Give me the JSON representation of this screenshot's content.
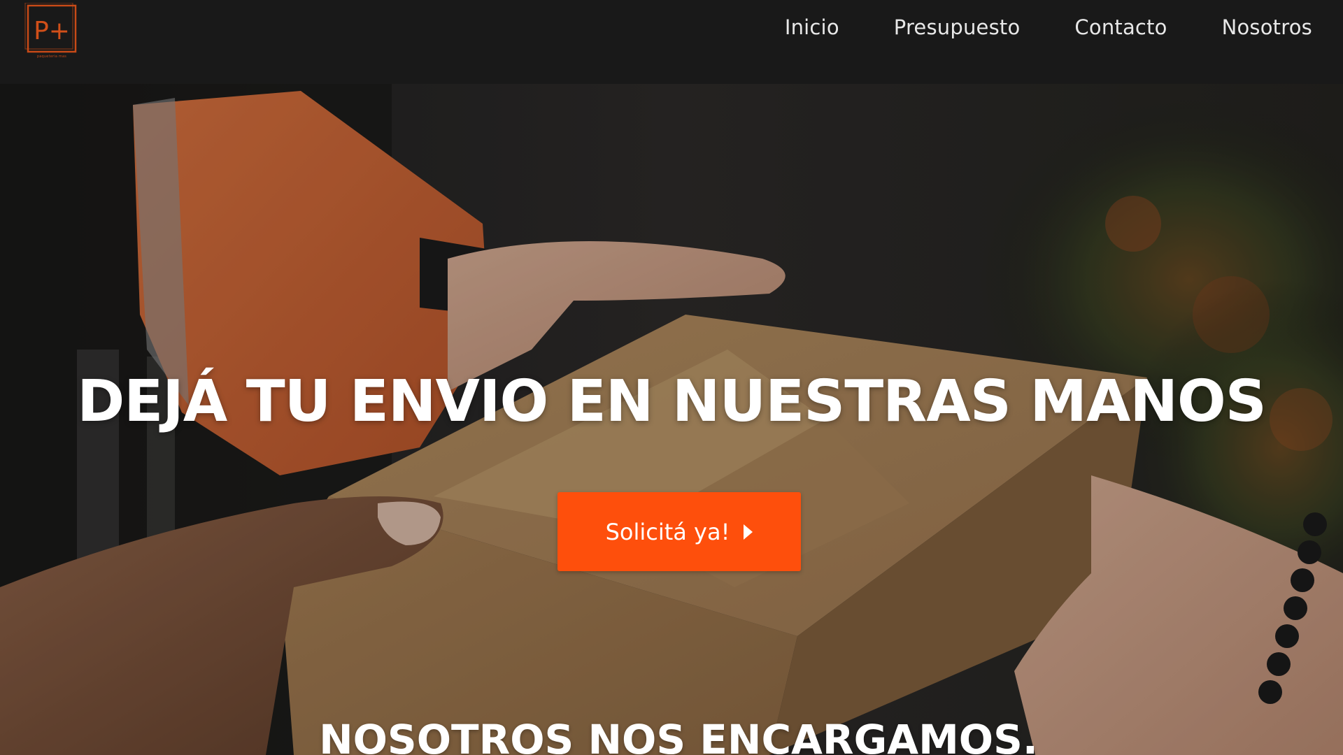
{
  "header": {
    "logo_mark": "P+",
    "logo_tagline": "paqueteria mas",
    "nav": [
      {
        "label": "Inicio"
      },
      {
        "label": "Presupuesto"
      },
      {
        "label": "Contacto"
      },
      {
        "label": "Nosotros"
      }
    ]
  },
  "hero": {
    "headline": "DEJÁ TU ENVIO EN NUESTRAS MANOS",
    "cta_label": "Solicitá ya!",
    "cta_icon": "caret-right-icon",
    "subline": "NOSOTROS NOS ENCARGAMOS.",
    "photo": "hands-passing-cardboard-box-photo"
  },
  "colors": {
    "header_bg": "#191919",
    "accent": "#fe4f0c",
    "nav_text": "#e8e8e8",
    "hero_text": "#ffffff"
  }
}
